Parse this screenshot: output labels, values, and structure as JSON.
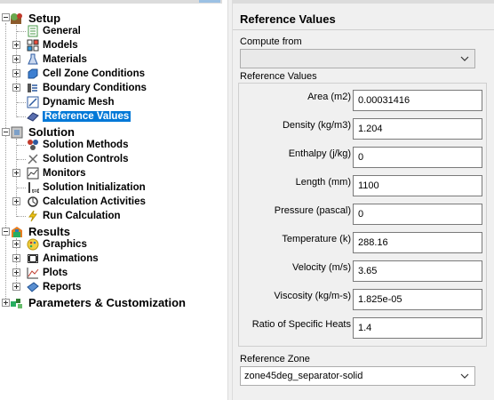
{
  "tree": {
    "setup": {
      "label": "Setup",
      "items": [
        "General",
        "Models",
        "Materials",
        "Cell Zone Conditions",
        "Boundary Conditions",
        "Dynamic Mesh",
        "Reference Values"
      ]
    },
    "solution": {
      "label": "Solution",
      "items": [
        "Solution Methods",
        "Solution Controls",
        "Monitors",
        "Solution Initialization",
        "Calculation Activities",
        "Run Calculation"
      ]
    },
    "results": {
      "label": "Results",
      "items": [
        "Graphics",
        "Animations",
        "Plots",
        "Reports"
      ]
    },
    "parameters": {
      "label": "Parameters & Customization"
    },
    "selected_item": "Reference Values"
  },
  "panel": {
    "title": "Reference Values",
    "compute_from": {
      "label": "Compute from",
      "value": ""
    },
    "group_label": "Reference Values",
    "fields": [
      {
        "label": "Area (m2)",
        "value": "0.00031416"
      },
      {
        "label": "Density (kg/m3)",
        "value": "1.204"
      },
      {
        "label": "Enthalpy (j/kg)",
        "value": "0"
      },
      {
        "label": "Length (mm)",
        "value": "1100"
      },
      {
        "label": "Pressure (pascal)",
        "value": "0"
      },
      {
        "label": "Temperature (k)",
        "value": "288.16"
      },
      {
        "label": "Velocity (m/s)",
        "value": "3.65"
      },
      {
        "label": "Viscosity (kg/m-s)",
        "value": "1.825e-05"
      },
      {
        "label": "Ratio of Specific Heats",
        "value": "1.4"
      }
    ],
    "reference_zone": {
      "label": "Reference Zone",
      "value": "zone45deg_separator-solid"
    }
  },
  "colors": {
    "selection": "#0078d7",
    "panel_bg": "#f0f0f0"
  }
}
